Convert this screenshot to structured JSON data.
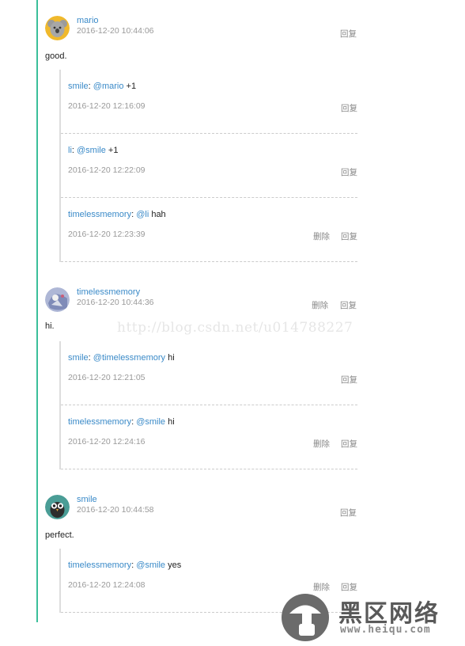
{
  "actions": {
    "reply": "回复",
    "delete": "删除"
  },
  "comments": [
    {
      "author": "mario",
      "time": "2016-12-20 10:44:06",
      "text": "good.",
      "replies": [
        {
          "from": "smile",
          "sep": ": ",
          "to": "@mario",
          "msg": " +1",
          "time": "2016-12-20 12:16:09",
          "deletable": false
        },
        {
          "from": "li",
          "sep": ": ",
          "to": "@smile",
          "msg": " +1",
          "time": "2016-12-20 12:22:09",
          "deletable": false
        },
        {
          "from": "timelessmemory",
          "sep": ": ",
          "to": "@li",
          "msg": " hah",
          "time": "2016-12-20 12:23:39",
          "deletable": true
        }
      ]
    },
    {
      "author": "timelessmemory",
      "time": "2016-12-20 10:44:36",
      "text": "hi.",
      "replies": [
        {
          "from": "smile",
          "sep": ": ",
          "to": "@timelessmemory",
          "msg": " hi",
          "time": "2016-12-20 12:21:05",
          "deletable": false
        },
        {
          "from": "timelessmemory",
          "sep": ": ",
          "to": "@smile",
          "msg": " hi",
          "time": "2016-12-20 12:24:16",
          "deletable": true
        }
      ]
    },
    {
      "author": "smile",
      "time": "2016-12-20 10:44:58",
      "text": "perfect.",
      "replies": [
        {
          "from": "timelessmemory",
          "sep": ": ",
          "to": "@smile",
          "msg": " yes",
          "time": "2016-12-20 12:24:08",
          "deletable": true
        }
      ]
    }
  ],
  "watermark": "http://blog.csdn.net/u014788227",
  "site": {
    "name": "黑区网络",
    "url": "www.heiqu.com"
  }
}
